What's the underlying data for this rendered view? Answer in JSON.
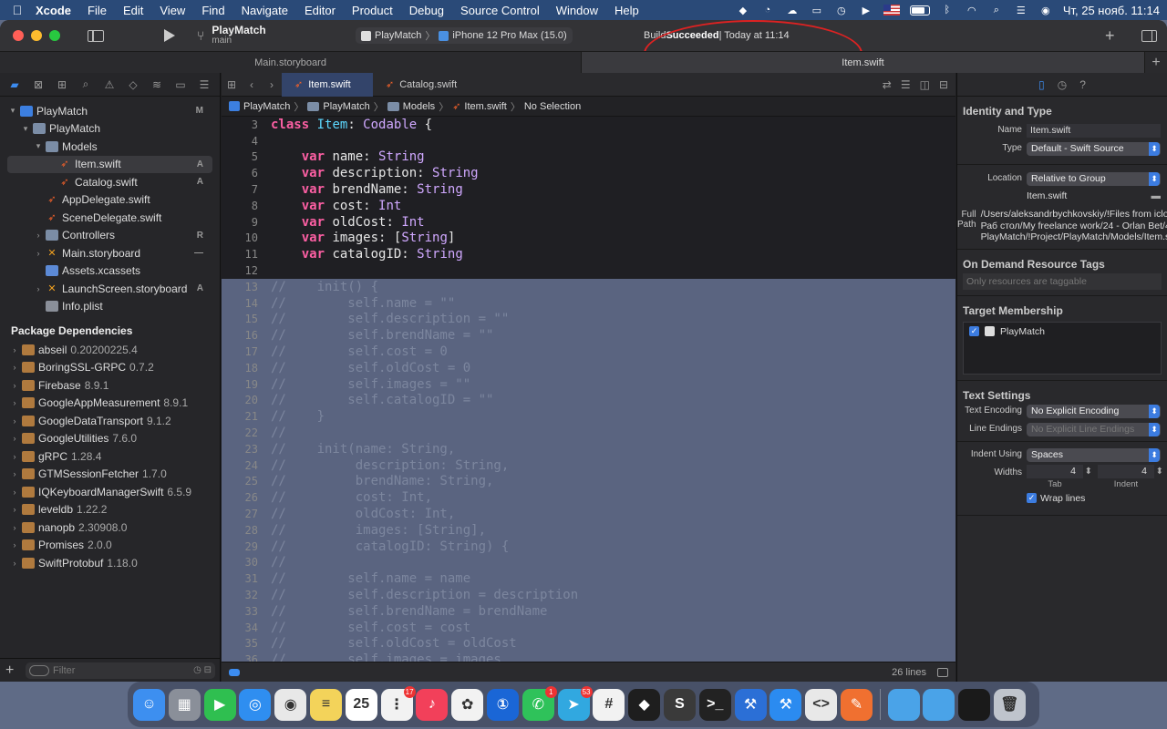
{
  "menubar": {
    "app": "Xcode",
    "menus": [
      "File",
      "Edit",
      "View",
      "Find",
      "Navigate",
      "Editor",
      "Product",
      "Debug",
      "Source Control",
      "Window",
      "Help"
    ],
    "clock": "Чт, 25 нояб.  11:14"
  },
  "toolbar": {
    "project": "PlayMatch",
    "branch": "main",
    "scheme": "PlayMatch",
    "device": "iPhone 12 Pro Max (15.0)",
    "status_prefix": "Build ",
    "status_bold": "Succeeded",
    "status_suffix": " | Today at 11:14"
  },
  "window_tabs": [
    "Main.storyboard",
    "Item.swift"
  ],
  "navigator": {
    "tree": [
      {
        "label": "PlayMatch",
        "indent": 0,
        "icon": "project-icon",
        "chev": "▾",
        "badge": "M"
      },
      {
        "label": "PlayMatch",
        "indent": 1,
        "icon": "folder-icon",
        "chev": "▾",
        "badge": ""
      },
      {
        "label": "Models",
        "indent": 2,
        "icon": "folder-icon",
        "chev": "▾",
        "badge": ""
      },
      {
        "label": "Item.swift",
        "indent": 3,
        "icon": "swift-file-icon",
        "chev": "",
        "badge": "A",
        "selected": true
      },
      {
        "label": "Catalog.swift",
        "indent": 3,
        "icon": "swift-file-icon",
        "chev": "",
        "badge": "A"
      },
      {
        "label": "AppDelegate.swift",
        "indent": 2,
        "icon": "swift-file-icon",
        "chev": "",
        "badge": ""
      },
      {
        "label": "SceneDelegate.swift",
        "indent": 2,
        "icon": "swift-file-icon",
        "chev": "",
        "badge": ""
      },
      {
        "label": "Controllers",
        "indent": 2,
        "icon": "folder-icon",
        "chev": "›",
        "badge": "R"
      },
      {
        "label": "Main.storyboard",
        "indent": 2,
        "icon": "storyboard-icon",
        "chev": "›",
        "badge": "—"
      },
      {
        "label": "Assets.xcassets",
        "indent": 2,
        "icon": "assets-icon",
        "chev": "",
        "badge": ""
      },
      {
        "label": "LaunchScreen.storyboard",
        "indent": 2,
        "icon": "storyboard-icon",
        "chev": "›",
        "badge": "A"
      },
      {
        "label": "Info.plist",
        "indent": 2,
        "icon": "plist-icon",
        "chev": "",
        "badge": ""
      }
    ],
    "packages_header": "Package Dependencies",
    "packages": [
      {
        "name": "abseil",
        "version": "0.20200225.4"
      },
      {
        "name": "BoringSSL-GRPC",
        "version": "0.7.2"
      },
      {
        "name": "Firebase",
        "version": "8.9.1"
      },
      {
        "name": "GoogleAppMeasurement",
        "version": "8.9.1"
      },
      {
        "name": "GoogleDataTransport",
        "version": "9.1.2"
      },
      {
        "name": "GoogleUtilities",
        "version": "7.6.0"
      },
      {
        "name": "gRPC",
        "version": "1.28.4"
      },
      {
        "name": "GTMSessionFetcher",
        "version": "1.7.0"
      },
      {
        "name": "IQKeyboardManagerSwift",
        "version": "6.5.9"
      },
      {
        "name": "leveldb",
        "version": "1.22.2"
      },
      {
        "name": "nanopb",
        "version": "2.30908.0"
      },
      {
        "name": "Promises",
        "version": "2.0.0"
      },
      {
        "name": "SwiftProtobuf",
        "version": "1.18.0"
      }
    ],
    "filter_placeholder": "Filter"
  },
  "editor": {
    "tabs": [
      "Item.swift",
      "Catalog.swift"
    ],
    "jumpbar": [
      "PlayMatch",
      "PlayMatch",
      "Models",
      "Item.swift",
      "No Selection"
    ],
    "lines": [
      {
        "n": "3",
        "t": "class Item: Codable {",
        "sel": false
      },
      {
        "n": "4",
        "t": "",
        "sel": false
      },
      {
        "n": "5",
        "t": "    var name: String",
        "sel": false
      },
      {
        "n": "6",
        "t": "    var description: String",
        "sel": false
      },
      {
        "n": "7",
        "t": "    var brendName: String",
        "sel": false
      },
      {
        "n": "8",
        "t": "    var cost: Int",
        "sel": false
      },
      {
        "n": "9",
        "t": "    var oldCost: Int",
        "sel": false
      },
      {
        "n": "10",
        "t": "    var images: [String]",
        "sel": false
      },
      {
        "n": "11",
        "t": "    var catalogID: String",
        "sel": false
      },
      {
        "n": "12",
        "t": "",
        "sel": false
      },
      {
        "n": "13",
        "t": "//    init() {",
        "sel": true
      },
      {
        "n": "14",
        "t": "//        self.name = \"\"",
        "sel": true
      },
      {
        "n": "15",
        "t": "//        self.description = \"\"",
        "sel": true
      },
      {
        "n": "16",
        "t": "//        self.brendName = \"\"",
        "sel": true
      },
      {
        "n": "17",
        "t": "//        self.cost = 0",
        "sel": true
      },
      {
        "n": "18",
        "t": "//        self.oldCost = 0",
        "sel": true
      },
      {
        "n": "19",
        "t": "//        self.images = \"\"",
        "sel": true
      },
      {
        "n": "20",
        "t": "//        self.catalogID = \"\"",
        "sel": true
      },
      {
        "n": "21",
        "t": "//    }",
        "sel": true
      },
      {
        "n": "22",
        "t": "//",
        "sel": true
      },
      {
        "n": "23",
        "t": "//    init(name: String,",
        "sel": true
      },
      {
        "n": "24",
        "t": "//         description: String,",
        "sel": true
      },
      {
        "n": "25",
        "t": "//         brendName: String,",
        "sel": true
      },
      {
        "n": "26",
        "t": "//         cost: Int,",
        "sel": true
      },
      {
        "n": "27",
        "t": "//         oldCost: Int,",
        "sel": true
      },
      {
        "n": "28",
        "t": "//         images: [String],",
        "sel": true
      },
      {
        "n": "29",
        "t": "//         catalogID: String) {",
        "sel": true
      },
      {
        "n": "30",
        "t": "//",
        "sel": true
      },
      {
        "n": "31",
        "t": "//        self.name = name",
        "sel": true
      },
      {
        "n": "32",
        "t": "//        self.description = description",
        "sel": true
      },
      {
        "n": "33",
        "t": "//        self.brendName = brendName",
        "sel": true
      },
      {
        "n": "34",
        "t": "//        self.cost = cost",
        "sel": true
      },
      {
        "n": "35",
        "t": "//        self.oldCost = oldCost",
        "sel": true
      },
      {
        "n": "36",
        "t": "//        self.images = images",
        "sel": true
      }
    ],
    "line_count": "26 lines"
  },
  "inspector": {
    "identity_title": "Identity and Type",
    "name_label": "Name",
    "name_value": "Item.swift",
    "type_label": "Type",
    "type_value": "Default - Swift Source",
    "location_label": "Location",
    "location_value": "Relative to Group",
    "location_file": "Item.swift",
    "fullpath_label": "Full Path",
    "fullpath_value": "/Users/aleksandrbychkovskiy/!Files from icloud/!Раб стол/My freelance work/24 - Orlan Bet/4 - PlayMatch/!Project/PlayMatch/Models/Item.swift",
    "odr_title": "On Demand Resource Tags",
    "odr_placeholder": "Only resources are taggable",
    "tm_title": "Target Membership",
    "tm_target": "PlayMatch",
    "ts_title": "Text Settings",
    "encoding_label": "Text Encoding",
    "encoding_value": "No Explicit Encoding",
    "endings_label": "Line Endings",
    "endings_value": "No Explicit Line Endings",
    "indent_label": "Indent Using",
    "indent_value": "Spaces",
    "widths_label": "Widths",
    "tab_value": "4",
    "tab_label": "Tab",
    "indent_w_value": "4",
    "indent_w_label": "Indent",
    "wrap_label": "Wrap lines"
  },
  "dock": {
    "apps": [
      {
        "name": "finder-icon",
        "color": "#3d8ff0",
        "glyph": "☺"
      },
      {
        "name": "launchpad-icon",
        "color": "#8a8f99",
        "glyph": "▦"
      },
      {
        "name": "facetime-icon",
        "color": "#2fbf50",
        "glyph": "▶"
      },
      {
        "name": "safari-icon",
        "color": "#2f8ef0",
        "glyph": "◎"
      },
      {
        "name": "chrome-icon",
        "color": "#e8e8e8",
        "glyph": "◉"
      },
      {
        "name": "notes-icon",
        "color": "#f3d35a",
        "glyph": "≡"
      },
      {
        "name": "calendar-icon",
        "color": "#ffffff",
        "glyph": "25"
      },
      {
        "name": "reminders-icon",
        "color": "#f2f2f2",
        "glyph": "⋮",
        "badge": "17"
      },
      {
        "name": "music-icon",
        "color": "#f2405a",
        "glyph": "♪"
      },
      {
        "name": "photos-icon",
        "color": "#f2f2f2",
        "glyph": "✿"
      },
      {
        "name": "1password-icon",
        "color": "#1a66d6",
        "glyph": "①"
      },
      {
        "name": "whatsapp-icon",
        "color": "#2fc25a",
        "glyph": "✆",
        "badge": "1"
      },
      {
        "name": "telegram-icon",
        "color": "#31a8e0",
        "glyph": "➤",
        "badge": "53"
      },
      {
        "name": "slack-icon",
        "color": "#f2f2f2",
        "glyph": "#"
      },
      {
        "name": "figma-icon",
        "color": "#1e1e1e",
        "glyph": "◆"
      },
      {
        "name": "sublime-icon",
        "color": "#3a3a3a",
        "glyph": "S"
      },
      {
        "name": "terminal-icon",
        "color": "#222222",
        "glyph": ">_"
      },
      {
        "name": "instruments-icon",
        "color": "#2b6fd6",
        "glyph": "⚒"
      },
      {
        "name": "xcode-icon",
        "color": "#2b8bf0",
        "glyph": "⚒"
      },
      {
        "name": "vscode-icon",
        "color": "#e8e8e8",
        "glyph": "<>"
      },
      {
        "name": "pen-icon",
        "color": "#f07030",
        "glyph": "✎"
      }
    ],
    "right": [
      {
        "name": "folder-icon",
        "color": "#4aa3e8",
        "glyph": ""
      },
      {
        "name": "folder-icon",
        "color": "#4aa3e8",
        "glyph": ""
      },
      {
        "name": "window-icon",
        "color": "#1a1a1a",
        "glyph": ""
      },
      {
        "name": "trash-icon",
        "color": "#bfc4cc",
        "glyph": "🗑"
      }
    ]
  }
}
